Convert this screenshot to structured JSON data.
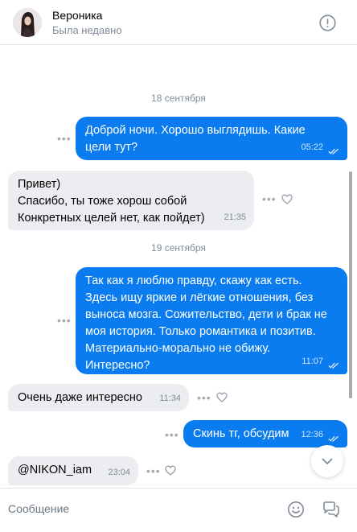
{
  "header": {
    "name": "Вероника",
    "status": "Была недавно"
  },
  "chat": {
    "date_1": "18 сентября",
    "date_2": "19 сентября",
    "messages": [
      {
        "direction": "out",
        "text": "Доброй ночи. Хорошо выглядишь. Какие\nцели тут?",
        "time": "05:22"
      },
      {
        "direction": "in",
        "text": "Привет)\nСпасибо, ты тоже хорош собой\nКонкретных целей нет, как пойдет)",
        "time": "21:35"
      },
      {
        "direction": "out",
        "text": "Так как я люблю правду, скажу как есть.\nЗдесь ищу яркие и лёгкие отношения, без\nвыноса мозга. Сожительство, дети и брак не\nмоя история. Только романтика и позитив.\nМатериально-морально не обижу.\nИнтересно?",
        "time": "11:07"
      },
      {
        "direction": "in",
        "text": "Очень даже интересно",
        "time": "11:34"
      },
      {
        "direction": "out",
        "text": "Скинь тг, обсудим",
        "time": "12:36"
      },
      {
        "direction": "in",
        "text": "@NIKON_iam",
        "time": "23:04"
      }
    ]
  },
  "composer": {
    "placeholder": "Сообщение"
  },
  "colors": {
    "outgoing_bubble": "#0a7cf0",
    "incoming_bubble": "#ebedf0",
    "secondary_text": "#818c99"
  },
  "icons": [
    "info-icon",
    "more-icon",
    "heart-icon",
    "double-check-icon",
    "chevron-down-icon",
    "emoji-icon",
    "stickers-icon"
  ]
}
